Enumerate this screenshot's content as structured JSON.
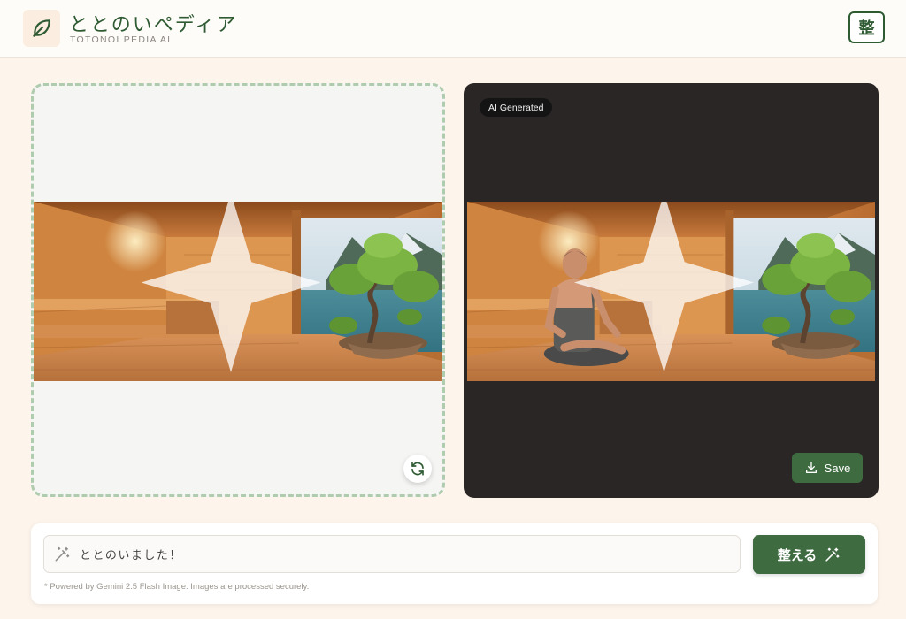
{
  "header": {
    "title": "ととのいペディア",
    "subtitle": "TOTONOI PEDIA AI",
    "kanji_button": "整"
  },
  "source_panel": {
    "image": "sauna-interior-with-bonsai-photo",
    "refresh_icon": "refresh-icon"
  },
  "result_panel": {
    "badge": "AI Generated",
    "image": "sauna-with-seated-man-photo",
    "save_label": "Save",
    "save_icon": "download-icon"
  },
  "prompt": {
    "value": "ととのいました！",
    "icon": "magic-wand-icon",
    "submit_label": "整える",
    "footnote": "* Powered by Gemini 2.5 Flash Image. Images are processed securely."
  },
  "colors": {
    "brand_green": "#3e6b40",
    "dark_panel": "#2a2625",
    "background": "#fdf5ec"
  }
}
